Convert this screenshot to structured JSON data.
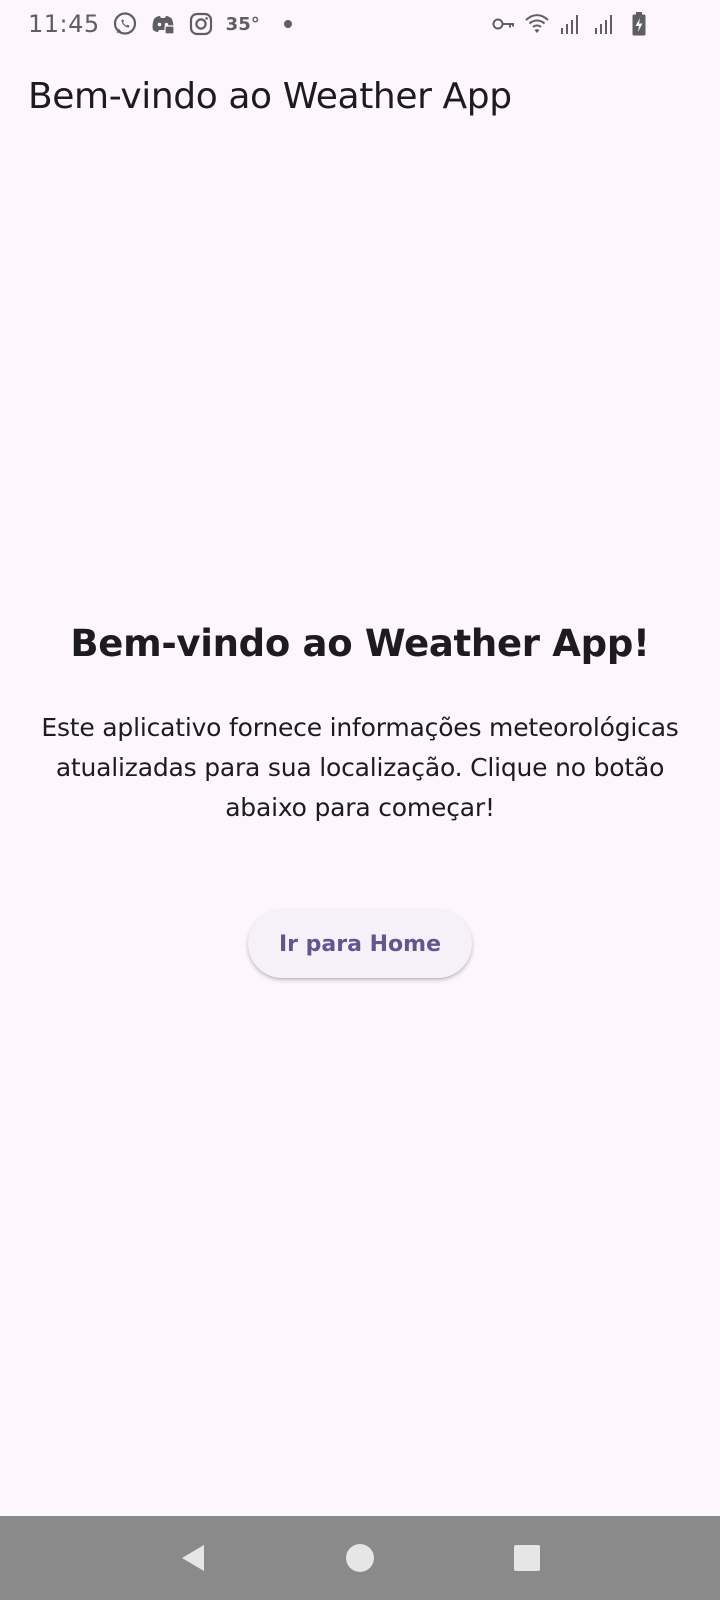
{
  "status_bar": {
    "time": "11:45",
    "temperature": "35°",
    "icons": [
      "whatsapp-icon",
      "discord-icon",
      "instagram-icon",
      "notification-dot",
      "vpn-key-icon",
      "wifi-icon",
      "signal-icon",
      "signal-icon",
      "battery-charging-icon"
    ]
  },
  "app_bar": {
    "title": "Bem-vindo ao Weather App"
  },
  "main": {
    "headline": "Bem-vindo ao Weather App!",
    "description": "Este aplicativo fornece informações meteorológicas atualizadas para sua localização. Clique no botão abaixo para começar!",
    "button_label": "Ir para Home"
  },
  "navigation": {
    "items": [
      "back",
      "home",
      "recents"
    ]
  },
  "colors": {
    "background": "#fdf7fd",
    "accent": "#65558f",
    "button_bg": "#f6f1f8",
    "nav_bar": "#8a8a8a"
  }
}
